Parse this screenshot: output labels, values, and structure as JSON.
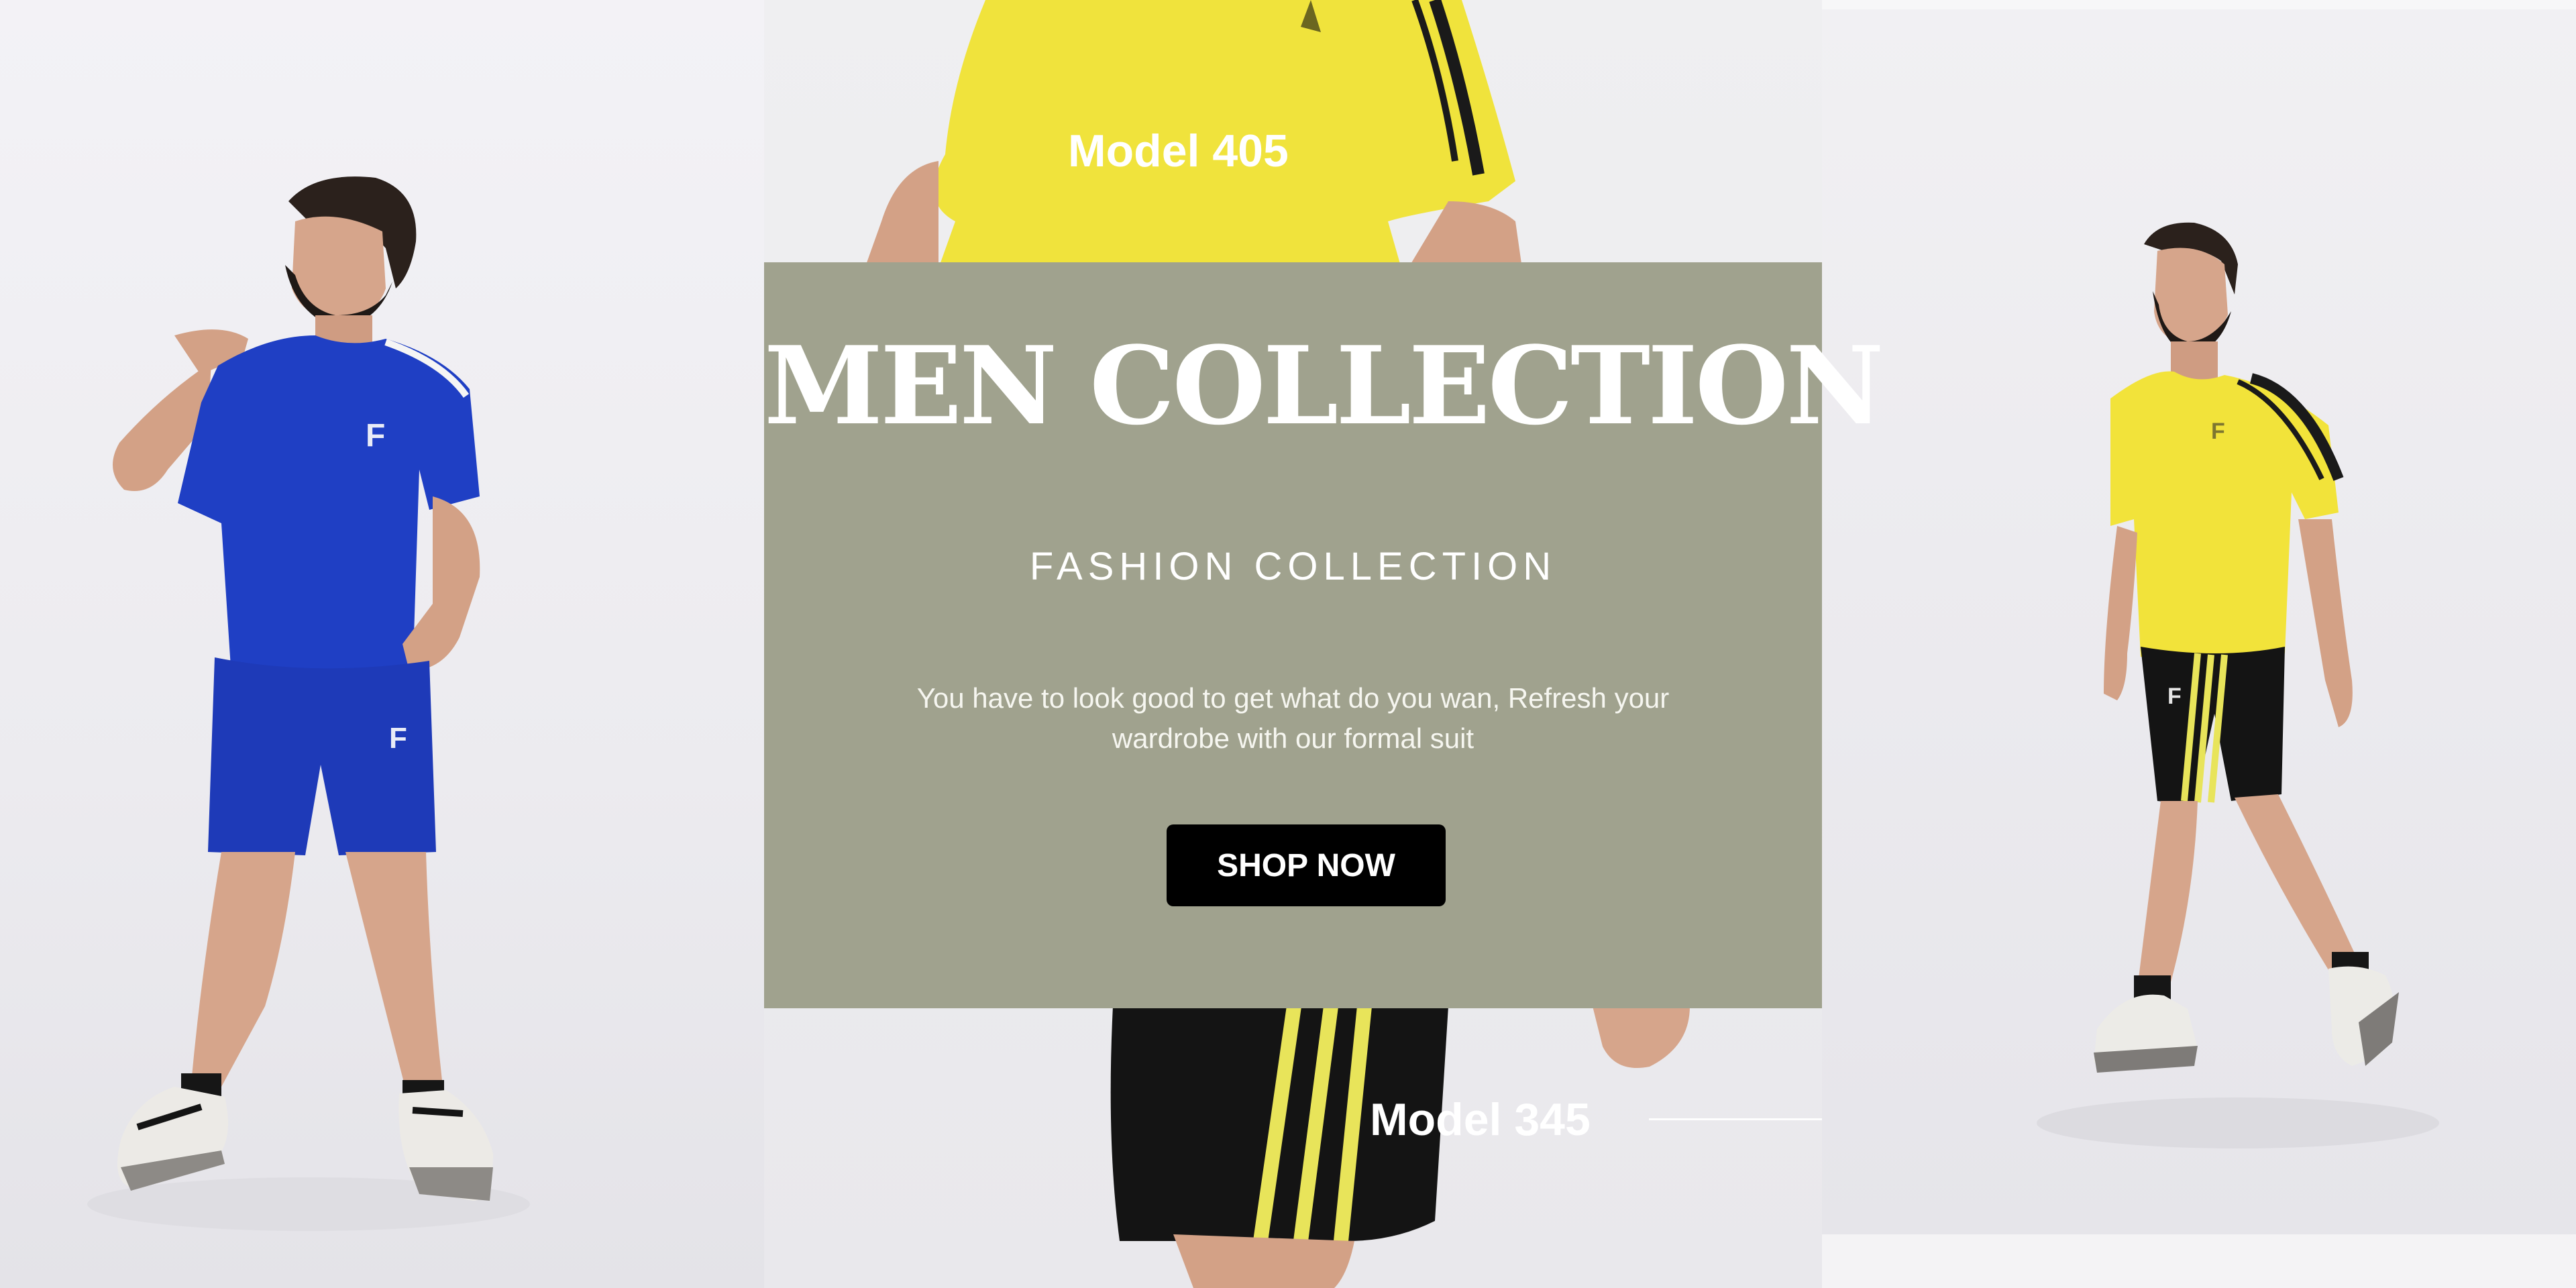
{
  "hero": {
    "title": "MEN COLLECTION",
    "subtitle": "FASHION COLLECTION",
    "description": "You have to look good to get what do you wan, Refresh your wardrobe with our formal suit",
    "button_label": "SHOP NOW"
  },
  "labels": {
    "model_top": "Model 405",
    "model_bottom": "Model 345"
  },
  "colors": {
    "card_background": "#a0a28e",
    "button_background": "#000000",
    "text": "#ffffff",
    "blue_outfit": "#1f3fc4",
    "yellow_shirt": "#f2e33a",
    "black_shorts": "#141414"
  },
  "logo_text": "F"
}
